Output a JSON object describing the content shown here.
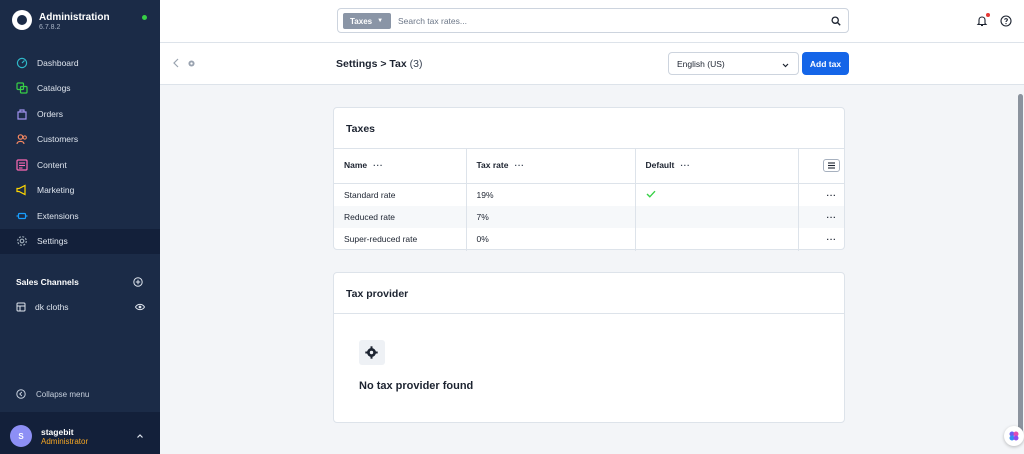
{
  "sidebar": {
    "brand": {
      "title": "Administration",
      "version": "6.7.8.2"
    },
    "nav": [
      {
        "label": "Dashboard",
        "icon": "dashboard-icon",
        "color": "#2fb8c8"
      },
      {
        "label": "Catalogs",
        "icon": "catalogs-icon",
        "color": "#37d046"
      },
      {
        "label": "Orders",
        "icon": "orders-icon",
        "color": "#a092f0"
      },
      {
        "label": "Customers",
        "icon": "customers-icon",
        "color": "#f88962"
      },
      {
        "label": "Content",
        "icon": "content-icon",
        "color": "#ff68b4"
      },
      {
        "label": "Marketing",
        "icon": "marketing-icon",
        "color": "#ffd700"
      },
      {
        "label": "Extensions",
        "icon": "extensions-icon",
        "color": "#189eff"
      },
      {
        "label": "Settings",
        "icon": "settings-icon",
        "color": "#9aa8b5"
      }
    ],
    "sales_channels": {
      "heading": "Sales Channels",
      "items": [
        {
          "label": "dk cloths"
        }
      ]
    },
    "collapse_label": "Collapse menu",
    "user": {
      "initial": "S",
      "name": "stagebit",
      "role": "Administrator"
    }
  },
  "header": {
    "search": {
      "type_label": "Taxes",
      "placeholder": "Search tax rates..."
    }
  },
  "smartbar": {
    "breadcrumb_parent": "Settings",
    "breadcrumb_sep": ">",
    "breadcrumb_current": "Tax",
    "count": "(3)",
    "language": "English (US)",
    "add_button": "Add tax"
  },
  "taxes_card": {
    "title": "Taxes",
    "columns": {
      "name": "Name",
      "rate": "Tax rate",
      "default": "Default"
    },
    "rows": [
      {
        "name": "Standard rate",
        "rate": "19%",
        "is_default": true
      },
      {
        "name": "Reduced rate",
        "rate": "7%",
        "is_default": false
      },
      {
        "name": "Super-reduced rate",
        "rate": "0%",
        "is_default": false
      }
    ],
    "row_actions": "···",
    "header_actions": "···"
  },
  "provider_card": {
    "title": "Tax provider",
    "empty_text": "No tax provider found"
  },
  "colors": {
    "sidebar_bg": "#1b2b47",
    "primary": "#1465e8",
    "check": "#37d046",
    "role": "#f5a623"
  }
}
